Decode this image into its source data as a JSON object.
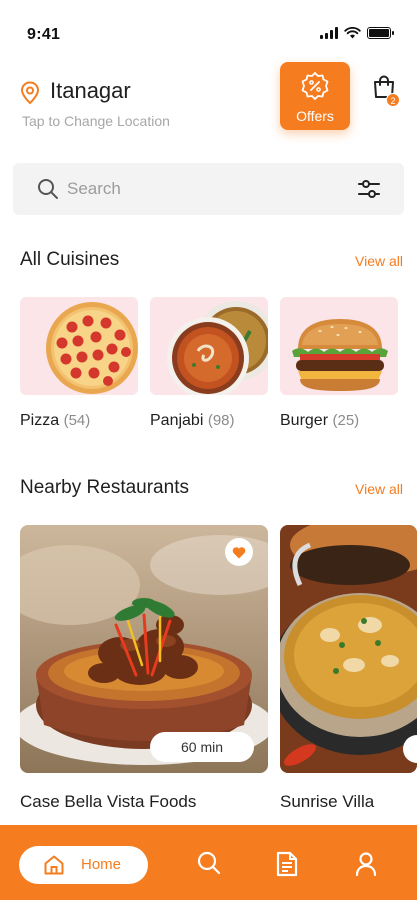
{
  "status_bar": {
    "time": "9:41"
  },
  "header": {
    "location": "Itanagar",
    "location_hint": "Tap to Change Location",
    "offers_label": "Offers",
    "cart_count": "2"
  },
  "search": {
    "placeholder": "Search"
  },
  "cuisines_section": {
    "title": "All Cuisines",
    "view_all": "View all",
    "items": [
      {
        "name": "Pizza",
        "count": "(54)"
      },
      {
        "name": "Panjabi",
        "count": "(98)"
      },
      {
        "name": "Burger",
        "count": "(25)"
      }
    ]
  },
  "nearby_section": {
    "title": "Nearby Restaurants",
    "view_all": "View all",
    "items": [
      {
        "name": "Case Bella Vista Foods",
        "eta": "60 min"
      },
      {
        "name": "Sunrise Villa"
      }
    ]
  },
  "bottom_nav": {
    "home_label": "Home",
    "items": [
      "home-icon",
      "search-icon",
      "document-icon",
      "profile-icon"
    ]
  },
  "colors": {
    "accent": "#f57c1f",
    "card_bg": "#fbe5e8"
  }
}
